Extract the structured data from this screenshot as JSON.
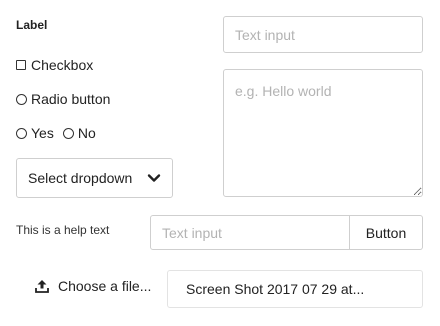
{
  "form": {
    "label": "Label",
    "top_input_placeholder": "Text input",
    "checkbox_label": "Checkbox",
    "radio_label": "Radio button",
    "radio_options": [
      "Yes",
      "No"
    ],
    "textarea_placeholder": "e.g. Hello world",
    "select_value": "Select dropdown",
    "help_text": "This is a help text",
    "group_input_placeholder": "Text input",
    "button_label": "Button",
    "file_choose_label": "Choose a file...",
    "file_name": "Screen Shot 2017 07 29 at..."
  },
  "icons": {
    "select": "chevron-down-icon",
    "file": "upload-icon"
  }
}
